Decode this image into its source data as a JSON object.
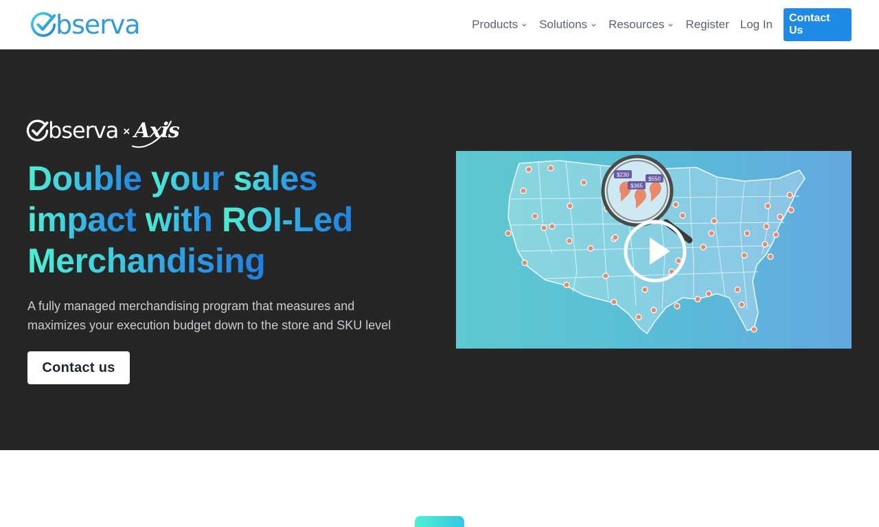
{
  "header": {
    "logo_text": "bserva",
    "nav": [
      {
        "label": "Products"
      },
      {
        "label": "Solutions"
      },
      {
        "label": "Resources"
      }
    ],
    "register_label": "Register",
    "login_label": "Log In",
    "contact_label": "Contact Us"
  },
  "hero": {
    "cobrand": {
      "brand": "bserva",
      "separator": "×",
      "partner": "Axis"
    },
    "headline": {
      "line1_a": "Double ",
      "line1_b": "your ",
      "line1_c": "sales",
      "line2_a": "impact ",
      "line2_b": "with ",
      "line2_c": "ROI-Led",
      "line3": "Merchandising"
    },
    "subtitle": "A fully managed merchandising program that measures and maximizes your execution budget down to the store and SKU level",
    "cta_label": "Contact us",
    "video": {
      "price_tags": [
        "$230",
        "$365",
        "$550"
      ]
    }
  },
  "colors": {
    "brand_blue": "#1f8ae6",
    "hero_bg": "#262626",
    "gradient_start": "#4ef0d2",
    "gradient_end": "#1e7fe0"
  }
}
